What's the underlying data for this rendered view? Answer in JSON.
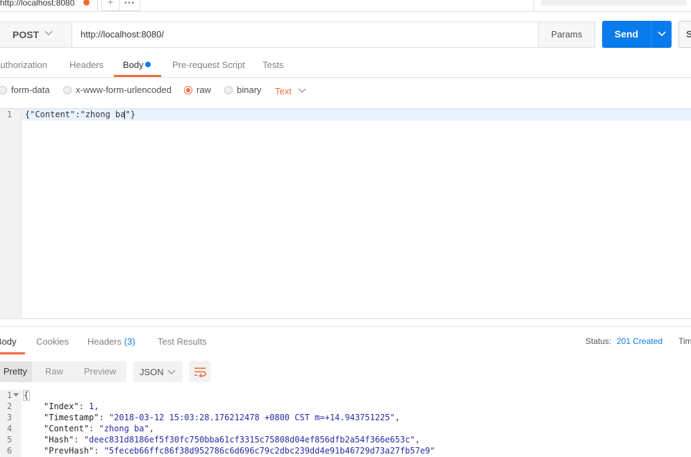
{
  "tabstrip": {
    "active_tab_title": "http://localhost:8080/",
    "add_tab_label": "+",
    "more_tabs_label": "•••"
  },
  "request": {
    "method": "POST",
    "url": "http://localhost:8080/",
    "params_label": "Params",
    "send_label": "Send",
    "save_label": "Save"
  },
  "request_tabs": {
    "authorization": "Authorization",
    "headers": "Headers",
    "body": "Body",
    "pre_request": "Pre-request Script",
    "tests": "Tests"
  },
  "body_types": {
    "form_data": "form-data",
    "urlencoded": "x-www-form-urlencoded",
    "raw": "raw",
    "binary": "binary",
    "selected": "raw",
    "content_type": "Text"
  },
  "request_editor": {
    "line_number": "1",
    "code": "{\"Content\":\"zhong ba\"}"
  },
  "response_tabs": {
    "body": "Body",
    "cookies": "Cookies",
    "headers": "Headers",
    "headers_count": "(3)",
    "test_results": "Test Results"
  },
  "response_status": {
    "status_label": "Status:",
    "status_value": "201 Created",
    "time_label": "Time"
  },
  "response_view": {
    "pretty": "Pretty",
    "raw": "Raw",
    "preview": "Preview",
    "format": "JSON"
  },
  "response_editor": {
    "line_numbers": [
      "1",
      "2",
      "3",
      "4",
      "5",
      "6"
    ],
    "open_brace": "{",
    "lines": [
      {
        "key": "\"Index\"",
        "value": "1",
        "suffix": ","
      },
      {
        "key": "\"Timestamp\"",
        "value": "\"2018-03-12 15:03:28.176212478 +0800 CST m=+14.943751225\"",
        "suffix": ","
      },
      {
        "key": "\"Content\"",
        "value": "\"zhong ba\"",
        "suffix": ","
      },
      {
        "key": "\"Hash\"",
        "value": "\"deec831d8186ef5f30fc750bba61cf3315c75808d04ef856dfb2a54f366e653c\"",
        "suffix": ","
      },
      {
        "key": "\"PrevHash\"",
        "value": "\"5feceb66ffc86f38d952786c6d696c79c2dbc239dd4e91b46729d73a27fb57e9\"",
        "suffix": ""
      }
    ]
  },
  "colors": {
    "accent_orange": "#f26b3a",
    "send_blue": "#097bed",
    "status_blue": "#097bed"
  }
}
